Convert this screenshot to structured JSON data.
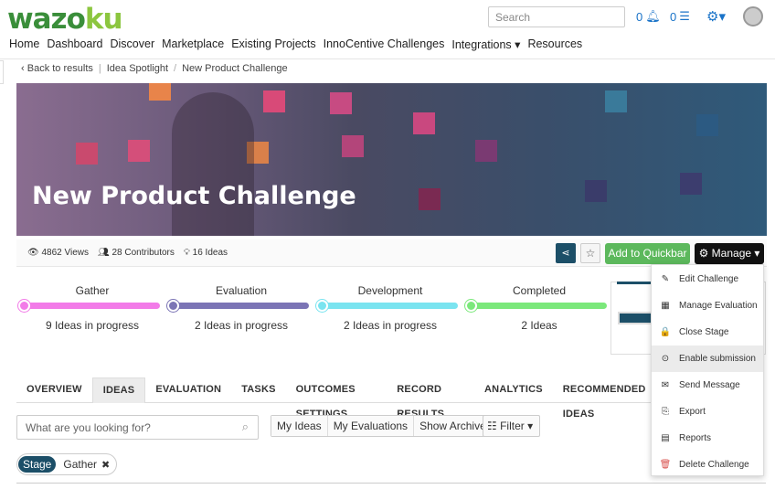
{
  "brand": {
    "logo_text_a": "wazo",
    "logo_text_b": "ku"
  },
  "header": {
    "search_placeholder": "Search",
    "notifications_count": "0",
    "messages_count": "0"
  },
  "nav": [
    "Home",
    "Dashboard",
    "Discover",
    "Marketplace",
    "Existing Projects",
    "InnoCentive Challenges",
    "Integrations ▾",
    "Resources"
  ],
  "breadcrumb": {
    "back": "Back to results",
    "section": "Idea Spotlight",
    "current": "New Product Challenge"
  },
  "banner": {
    "title": "New Product Challenge"
  },
  "stats": {
    "views": "4862 Views",
    "contributors": "28 Contributors",
    "ideas": "16 Ideas"
  },
  "actions": {
    "quickbar": "Add to Quickbar",
    "manage": "Manage"
  },
  "stages": [
    {
      "name": "Gather",
      "sub": "9 Ideas in progress",
      "color": "#f27be8",
      "dot": "#f27be8"
    },
    {
      "name": "Evaluation",
      "sub": "2 Ideas in progress",
      "color": "#7b74b5",
      "dot": "#7b74b5"
    },
    {
      "name": "Development",
      "sub": "2 Ideas in progress",
      "color": "#7ae4f0",
      "dot": "#7ae4f0"
    },
    {
      "name": "Completed",
      "sub": "2 Ideas",
      "color": "#7be87b",
      "dot": "#7be87b"
    }
  ],
  "tabs": [
    "OVERVIEW",
    "IDEAS",
    "EVALUATION",
    "TASKS",
    "OUTCOMES SETTINGS",
    "RECORD RESULTS",
    "ANALYTICS",
    "RECOMMENDED IDEAS"
  ],
  "active_tab": "IDEAS",
  "ideas_search_placeholder": "What are you looking for?",
  "segments": [
    "My Ideas",
    "My Evaluations",
    "Show Archived"
  ],
  "filter_label": "Filter",
  "chip": {
    "label": "Stage",
    "value": "Gather"
  },
  "menu": [
    {
      "label": "Edit Challenge",
      "icon": "pencil-icon",
      "glyph": "✎"
    },
    {
      "label": "Manage Evaluation",
      "icon": "grid-icon",
      "glyph": "▦"
    },
    {
      "label": "Close Stage",
      "icon": "lock-icon",
      "glyph": "🔒"
    },
    {
      "label": "Enable submission",
      "icon": "check-circle-icon",
      "glyph": "⊙"
    },
    {
      "label": "Send Message",
      "icon": "envelope-icon",
      "glyph": "✉"
    },
    {
      "label": "Export",
      "icon": "export-icon",
      "glyph": "⎘"
    },
    {
      "label": "Reports",
      "icon": "report-icon",
      "glyph": "▤"
    },
    {
      "label": "Delete Challenge",
      "icon": "trash-icon",
      "glyph": "🗑"
    }
  ],
  "colors": {
    "brand_dark": "#1c4f68",
    "green": "#5cb85c",
    "logo_green": "#3a8e3a",
    "delete_red": "#d9534f"
  }
}
